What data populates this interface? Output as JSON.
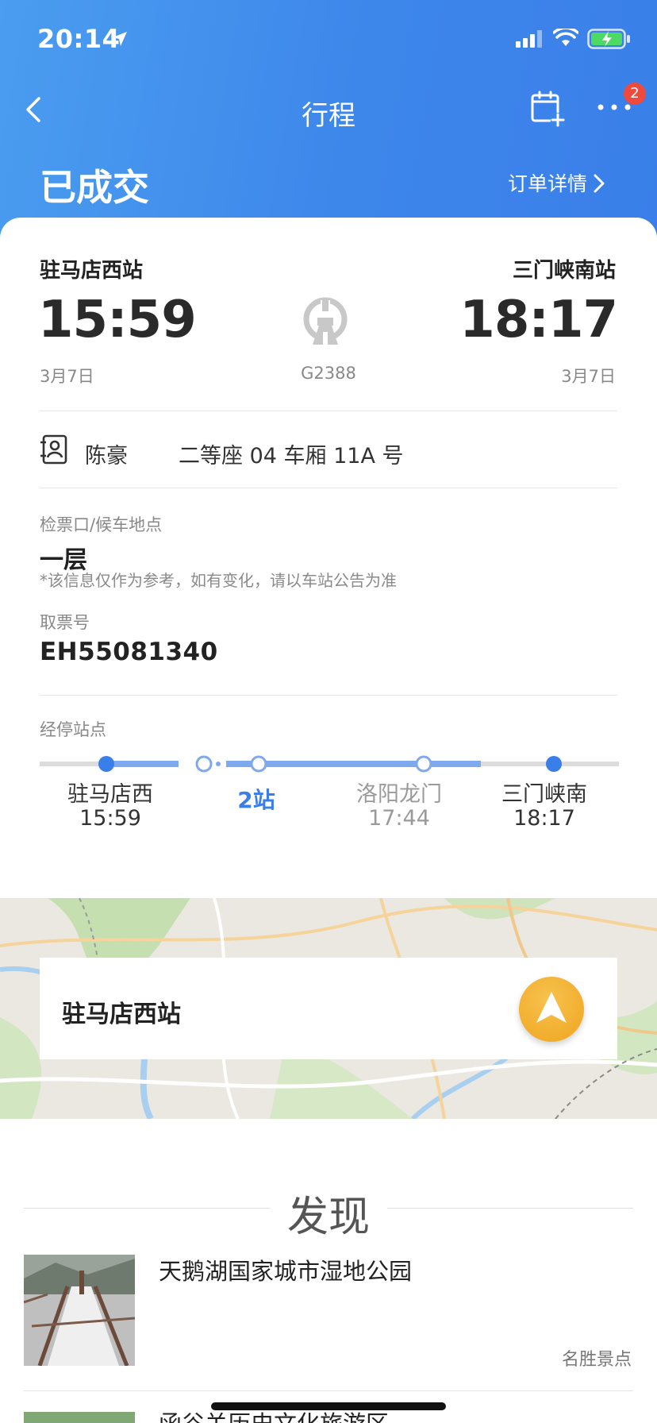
{
  "status_bar": {
    "time": "20:14"
  },
  "nav": {
    "title": "行程",
    "badge_count": "2"
  },
  "order": {
    "status": "已成交",
    "detail_link": "订单详情"
  },
  "trip": {
    "from_station": "驻马店西站",
    "to_station": "三门峡南站",
    "depart_time": "15:59",
    "arrive_time": "18:17",
    "depart_date": "3月7日",
    "arrive_date": "3月7日",
    "train_number": "G2388"
  },
  "passenger": {
    "name": "陈豪",
    "seat": "二等座 04 车厢 11A 号"
  },
  "gate": {
    "label": "检票口/候车地点",
    "value": "一层",
    "note": "*该信息仅作为参考，如有变化，请以车站公告为准"
  },
  "ticket": {
    "label": "取票号",
    "value": "EH55081340"
  },
  "stops": {
    "label": "经停站点",
    "count_label": "2站",
    "items": [
      {
        "name": "驻马店西",
        "time": "15:59"
      },
      {
        "name": "洛阳龙门",
        "time": "17:44"
      },
      {
        "name": "三门峡南",
        "time": "18:17"
      }
    ]
  },
  "map": {
    "station": "驻马店西站"
  },
  "discover": {
    "title": "发现",
    "items": [
      {
        "title": "天鹅湖国家城市湿地公园",
        "tag": "名胜景点"
      },
      {
        "title": "函谷关历史文化旅游区"
      }
    ]
  },
  "colors": {
    "header_blue": "#3d86ea",
    "accent_blue": "#3a7fe9",
    "nav_orange": "#efa51f",
    "badge_red": "#f04a3e"
  }
}
